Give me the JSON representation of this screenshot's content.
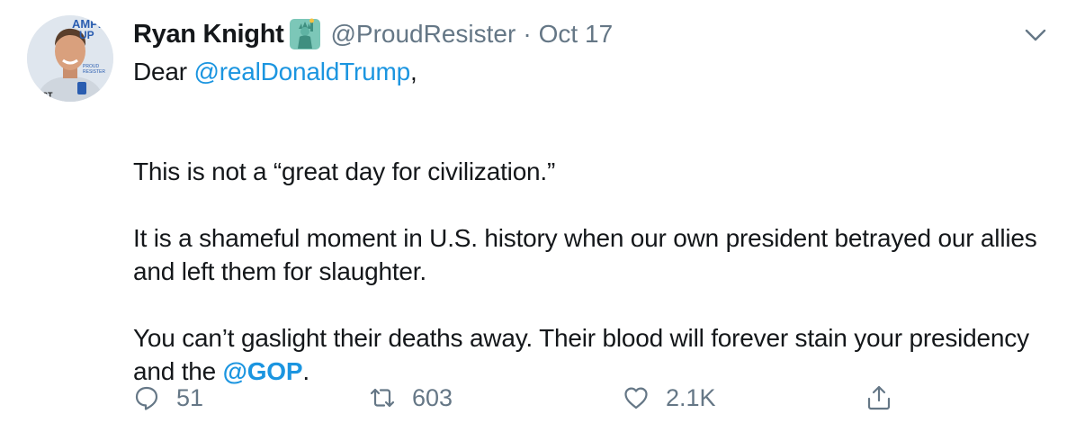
{
  "tweet": {
    "author_name": "Ryan Knight",
    "author_emoji": "statue-of-liberty-icon",
    "handle": "@ProudResister",
    "separator": "·",
    "date": "Oct 17",
    "avatar_text": {
      "line1": "AMPEL",
      "line2": "UP",
      "line3": "PROUD",
      "line4": "RESISTER",
      "line5": "ISIST"
    },
    "body": {
      "line1_prefix": "Dear ",
      "line1_mention": "@realDonaldTrump",
      "line1_suffix": ",",
      "para2": "This is not a “great day for civilization.”",
      "para3": "It is a shameful moment in U.S. history when our own president betrayed our allies and left them for slaughter.",
      "para4_prefix": "You can’t gaslight their deaths away. Their blood will forever stain your presidency and the ",
      "para4_mention": "@GOP",
      "para4_suffix": "."
    },
    "actions": {
      "replies": "51",
      "retweets": "603",
      "likes": "2.1K"
    }
  },
  "colors": {
    "text": "#14171a",
    "secondary": "#657786",
    "link": "#1b95e0"
  }
}
